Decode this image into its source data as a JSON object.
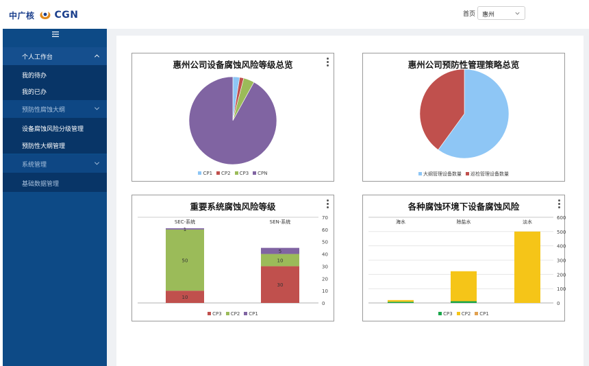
{
  "header": {
    "logo_cn": "中广核",
    "logo_en": "CGN",
    "home_label": "首页",
    "city_select": {
      "value": "惠州",
      "icon": "chevron-down-icon"
    }
  },
  "sidebar": {
    "toggle_icon": "menu-fold-icon",
    "groups": [
      {
        "label": "个人工作台",
        "expanded": true,
        "items": [
          "我的待办",
          "我的已办"
        ]
      },
      {
        "label": "预防性腐蚀大纲",
        "expanded": true,
        "items": [
          "设备腐蚀风险分级管理",
          "预防性大纲管理"
        ]
      },
      {
        "label": "系统管理",
        "expanded": true,
        "items": [
          "基础数据管理"
        ]
      }
    ]
  },
  "colors": {
    "sidebar_bg": "#0d4a86",
    "light_blue": "#8ec6f5",
    "red": "#c0504d",
    "green": "#9bbb59",
    "purple": "#8064a2",
    "yellow": "#f5c518",
    "dark_green": "#1aa64a"
  },
  "charts": {
    "c1": {
      "title": "惠州公司设备腐蚀风险等级总览",
      "chart_data": {
        "type": "pie",
        "labels": [
          "CP1",
          "CP2",
          "CP3",
          "CPN"
        ],
        "values": [
          2.5,
          1.5,
          4,
          92
        ],
        "colors": [
          "#8ec6f5",
          "#c0504d",
          "#9bbb59",
          "#8064a2"
        ]
      }
    },
    "c2": {
      "title": "惠州公司预防性管理策略总览",
      "chart_data": {
        "type": "pie",
        "labels": [
          "大纲管理设备数量",
          "巡检管理设备数量"
        ],
        "values": [
          60,
          40
        ],
        "colors": [
          "#8ec6f5",
          "#c0504d"
        ]
      }
    },
    "c3": {
      "title": "重要系统腐蚀风险等级",
      "chart_data": {
        "type": "bar",
        "stacked": true,
        "categories": [
          "SEC-系统",
          "SEN-系统"
        ],
        "series": [
          {
            "name": "CP3",
            "values": [
              10,
              30
            ],
            "color": "#c0504d"
          },
          {
            "name": "CP2",
            "values": [
              50,
              10
            ],
            "color": "#9bbb59"
          },
          {
            "name": "CP1",
            "values": [
              1,
              5
            ],
            "color": "#8064a2"
          }
        ],
        "y_ticks": [
          "0",
          "10",
          "20",
          "30",
          "40",
          "50",
          "60",
          "70"
        ],
        "ylim": [
          0,
          70
        ],
        "legend": [
          "CP3",
          "CP2",
          "CP1"
        ],
        "legend_colors": [
          "#c0504d",
          "#9bbb59",
          "#8064a2"
        ],
        "legend_position": "bottom",
        "y_axis": "right",
        "x_labels_position": "top"
      }
    },
    "c4": {
      "title": "各种腐蚀环境下设备腐蚀风险",
      "chart_data": {
        "type": "bar",
        "stacked": true,
        "categories": [
          "海水",
          "除盐水",
          "淡水"
        ],
        "series": [
          {
            "name": "CP3",
            "values": [
              8,
              12,
              0
            ],
            "color": "#1aa64a"
          },
          {
            "name": "CP2",
            "values": [
              12,
              210,
              500
            ],
            "color": "#f5c518"
          }
        ],
        "y_ticks": [
          "0",
          "100",
          "200",
          "300",
          "400",
          "500",
          "600"
        ],
        "ylim": [
          0,
          600
        ],
        "legend": [
          "CP3",
          "CP2",
          "CP1"
        ],
        "legend_colors": [
          "#1aa64a",
          "#f5c518",
          "#e0a050"
        ],
        "legend_position": "bottom",
        "y_axis": "right",
        "x_labels_position": "top",
        "grid": true
      }
    }
  }
}
